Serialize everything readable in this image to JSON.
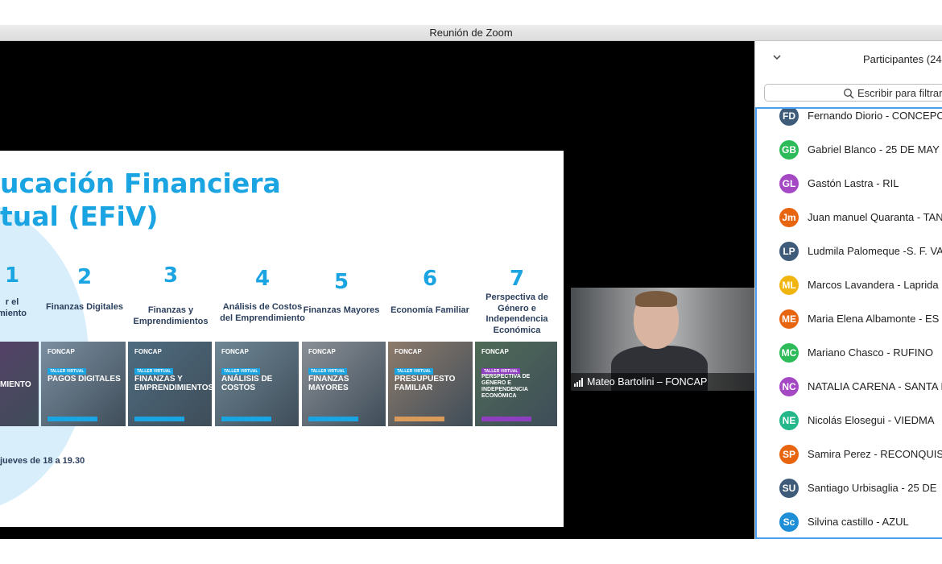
{
  "window": {
    "title": "Reunión de Zoom"
  },
  "slide": {
    "title_line1": "ucación Financiera",
    "title_line2": "tual (EFiV)",
    "modules": [
      {
        "num": "1",
        "label": "r el\nmiento"
      },
      {
        "num": "2",
        "label": "Finanzas Digitales"
      },
      {
        "num": "3",
        "label": "Finanzas y\nEmprendimientos"
      },
      {
        "num": "4",
        "label": "Análisis de Costos\ndel Emprendimiento"
      },
      {
        "num": "5",
        "label": "Finanzas Mayores"
      },
      {
        "num": "6",
        "label": "Economía Familiar"
      },
      {
        "num": "7",
        "label": "Perspectiva de\nGénero e\nIndependencia\nEconómica"
      }
    ],
    "thumbs": [
      {
        "logo": "",
        "tag": "",
        "title": "MIENTO",
        "color": "#5b3d6b"
      },
      {
        "logo": "FONCAP",
        "tag": "TALLER VIRTUAL",
        "title": "PAGOS DIGITALES",
        "color": "#7b8fa1"
      },
      {
        "logo": "FONCAP",
        "tag": "TALLER VIRTUAL",
        "title": "FINANZAS Y EMPRENDIMIENTOS",
        "color": "#4e6c80"
      },
      {
        "logo": "FONCAP",
        "tag": "TALLER VIRTUAL",
        "title": "ANÁLISIS DE COSTOS",
        "color": "#6f8796"
      },
      {
        "logo": "FONCAP",
        "tag": "TALLER VIRTUAL",
        "title": "FINANZAS MAYORES",
        "color": "#8a8f96"
      },
      {
        "logo": "FONCAP",
        "tag": "TALLER VIRTUAL",
        "title": "PRESUPUESTO FAMILIAR",
        "color": "#8d7b6b"
      },
      {
        "logo": "FONCAP",
        "tag": "TALLER VIRTUAL",
        "title": "PERSPECTIVA DE GÉNERO E INDEPENDENCIA ECONÓMICA",
        "color": "#4f6b57"
      }
    ],
    "schedule": "jueves de 18 a 19.30"
  },
  "camera": {
    "participant_name": "Mateo Bartolini – FONCAP"
  },
  "participants_panel": {
    "title": "Participantes (24",
    "search_placeholder": "Escribir para filtrar",
    "participants": [
      {
        "initials": "FD",
        "name": "Fernando Diorio - CONCEPC",
        "color": "#3e5b7a"
      },
      {
        "initials": "GB",
        "name": "Gabriel Blanco - 25 DE MAY",
        "color": "#2dbb59"
      },
      {
        "initials": "GL",
        "name": "Gastón Lastra - RIL",
        "color": "#a548c4"
      },
      {
        "initials": "Jm",
        "name": "Juan manuel Quaranta - TAN",
        "color": "#e8650f"
      },
      {
        "initials": "LP",
        "name": "Ludmila Palomeque -S. F. VA",
        "color": "#3e5b7a"
      },
      {
        "initials": "ML",
        "name": "Marcos Lavandera - Laprida",
        "color": "#f1b50f"
      },
      {
        "initials": "ME",
        "name": "Maria Elena Albamonte - ES",
        "color": "#e8650f"
      },
      {
        "initials": "MC",
        "name": "Mariano Chasco - RUFINO",
        "color": "#2dbb59"
      },
      {
        "initials": "NC",
        "name": "NATALIA CARENA - SANTA I",
        "color": "#a548c4"
      },
      {
        "initials": "NE",
        "name": "Nicolás Elosegui - VIEDMA",
        "color": "#23b78a"
      },
      {
        "initials": "SP",
        "name": "Samira Perez - RECONQUIS",
        "color": "#e8650f"
      },
      {
        "initials": "SU",
        "name": "Santiago Urbisaglia - 25 DE",
        "color": "#3e5b7a"
      },
      {
        "initials": "Sc",
        "name": "Silvina castillo - AZUL",
        "color": "#1e8fd6"
      }
    ]
  }
}
